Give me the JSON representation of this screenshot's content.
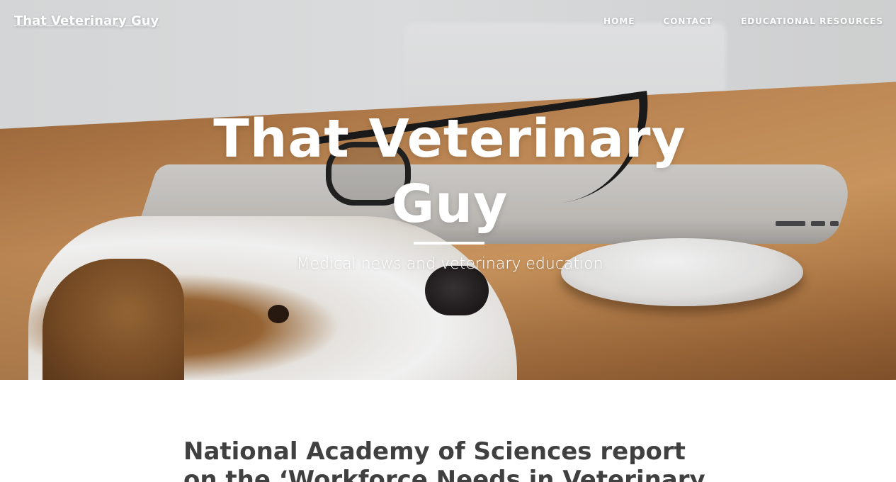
{
  "site": {
    "brand": "That Veterinary Guy"
  },
  "nav": {
    "items": [
      {
        "label": "HOME"
      },
      {
        "label": "CONTACT"
      },
      {
        "label": "EDUCATIONAL RESOURCES"
      }
    ]
  },
  "hero": {
    "title": "That Veterinary Guy",
    "subtitle": "Medical news and veterinary education"
  },
  "post": {
    "title": "National Academy of Sciences report on the ‘Workforce Needs in Veterinary"
  },
  "colors": {
    "text_white": "#ffffff",
    "post_title": "#404040",
    "desk_wood": "#c78f59"
  }
}
